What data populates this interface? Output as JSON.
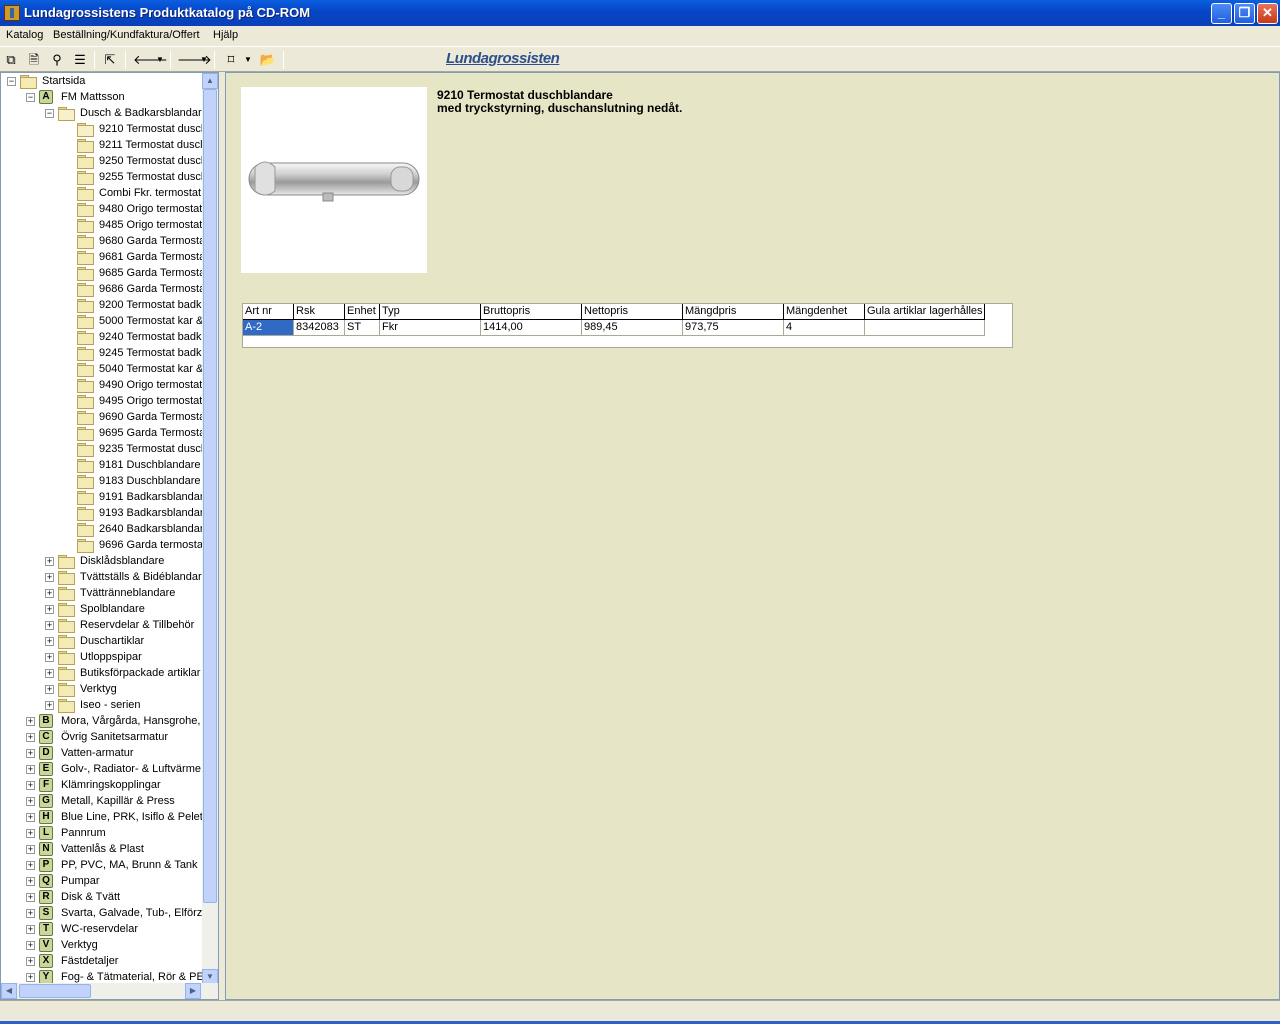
{
  "window": {
    "title": "Lundagrossistens Produktkatalog på CD-ROM"
  },
  "menu": [
    "Katalog",
    "Beställning/Kundfaktura/Offert",
    "Hjälp"
  ],
  "toolbar": {
    "logo_text": "Lundagrossisten"
  },
  "tree": {
    "root": "Startsida",
    "manufacturer_a": {
      "letter": "A",
      "label": "FM Mattsson"
    },
    "category_open": "Dusch & Badkarsblandare",
    "products": [
      "9210 Termostat duscl",
      "9211 Termostat duscl",
      "9250 Termostat duscl",
      "9255 Termostat duscl",
      "Combi Fkr. termostat d",
      "9480 Origo termostat",
      "9485 Origo termostat",
      "9680 Garda Termosta",
      "9681 Garda Termosta",
      "9685 Garda Termosta",
      "9686 Garda Termosta",
      "9200 Termostat badk",
      "5000 Termostat kar &",
      "9240 Termostat badk",
      "9245 Termostat badk",
      "5040 Termostat kar &",
      "9490 Origo termostat",
      "9495 Origo termostat",
      "9690 Garda Termosta",
      "9695 Garda Termosta",
      "9235 Termostat duscl",
      "9181 Duschblandare",
      "9183 Duschblandare",
      "9191 Badkarsblandar",
      "9193 Badkarsblandar",
      "2640 Badkarsblandar",
      "9696 Garda termostat"
    ],
    "categories": [
      "Disklådsblandare",
      "Tvättställs & Bidéblandare",
      "Tvättränneblandare",
      "Spolblandare",
      "Reservdelar & Tillbehör",
      "Duschartiklar",
      "Utloppspipar",
      "Butiksförpackade artiklar",
      "Verktyg",
      "Iseo - serien"
    ],
    "manufacturers": [
      {
        "letter": "B",
        "label": "Mora, Vårgårda, Hansgrohe, F"
      },
      {
        "letter": "C",
        "label": "Övrig Sanitetsarmatur"
      },
      {
        "letter": "D",
        "label": "Vatten-armatur"
      },
      {
        "letter": "E",
        "label": "Golv-, Radiator- & Luftvärme"
      },
      {
        "letter": "F",
        "label": "Klämringskopplingar"
      },
      {
        "letter": "G",
        "label": "Metall, Kapillär & Press"
      },
      {
        "letter": "H",
        "label": "Blue Line, PRK, Isiflo & Pelett"
      },
      {
        "letter": "L",
        "label": "Pannrum"
      },
      {
        "letter": "N",
        "label": "Vattenlås & Plast"
      },
      {
        "letter": "P",
        "label": "PP, PVC, MA, Brunn & Tank"
      },
      {
        "letter": "Q",
        "label": "Pumpar"
      },
      {
        "letter": "R",
        "label": "Disk & Tvätt"
      },
      {
        "letter": "S",
        "label": "Svarta, Galvade, Tub-, Elförzi"
      },
      {
        "letter": "T",
        "label": "WC-reservdelar"
      },
      {
        "letter": "V",
        "label": "Verktyg"
      },
      {
        "letter": "X",
        "label": "Fästdetaljer"
      },
      {
        "letter": "Y",
        "label": "Fog- & Tätmaterial, Rör & PEX"
      }
    ]
  },
  "product": {
    "title": "9210 Termostat duschblandare",
    "subtitle": "med tryckstyrning, duschanslutning nedåt."
  },
  "table": {
    "headers": [
      "Art nr",
      "Rsk",
      "Enhet",
      "Typ",
      "Bruttopris",
      "Nettopris",
      "Mängdpris",
      "Mängdenhet",
      "Gula artiklar lagerhålles i"
    ],
    "row": [
      "A-2",
      "8342083",
      "ST",
      "Fkr",
      "1414,00",
      "989,45",
      "973,75",
      "4",
      ""
    ]
  },
  "colors": {
    "titlebar": "#0747c9",
    "content_bg": "#e6e6c6",
    "selection": "#316ac5"
  }
}
